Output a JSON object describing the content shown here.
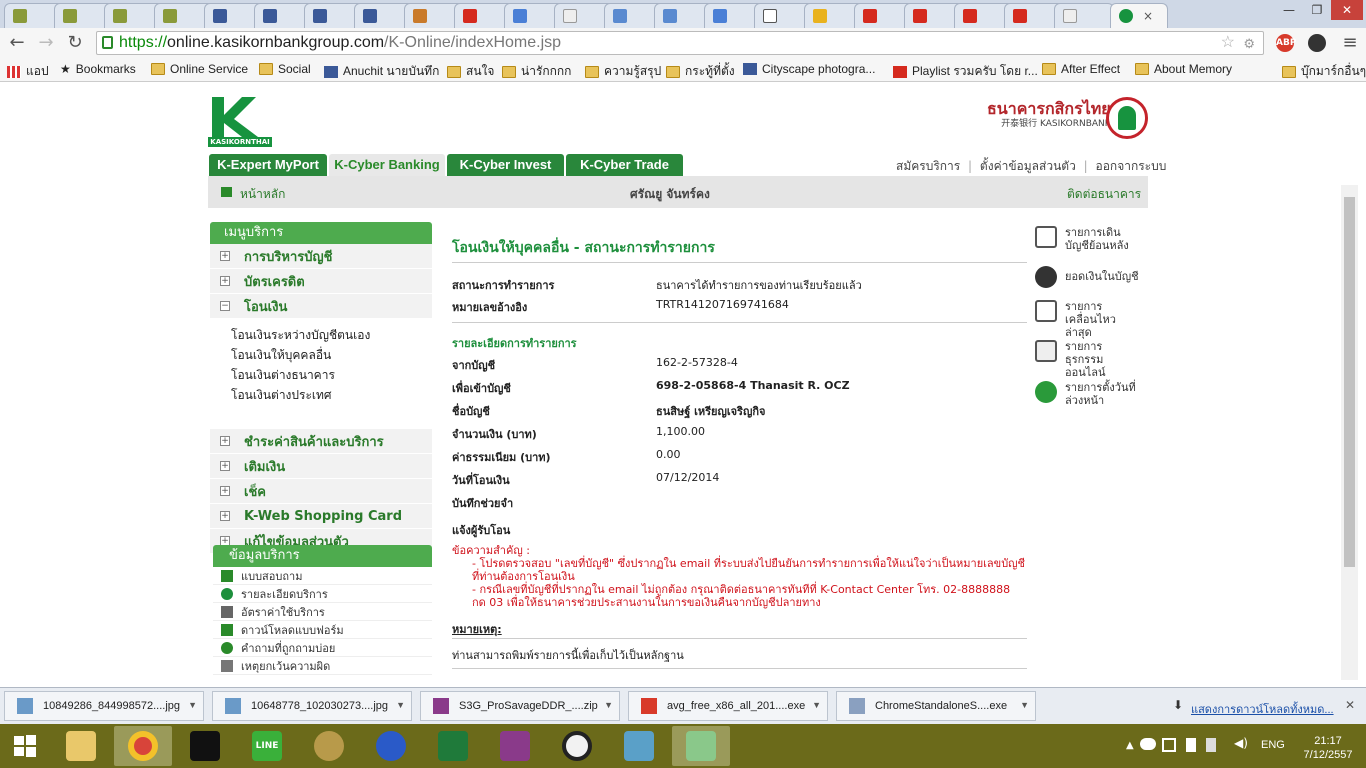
{
  "browser": {
    "active_tab_close": "×",
    "window_controls": [
      "—",
      "❐",
      "✕"
    ],
    "url_https": "https://",
    "url_host": "online.kasikornbankgroup.com",
    "url_path": "/K-Online/indexHome.jsp",
    "extensions": [
      "ABP"
    ]
  },
  "bookmarks": {
    "items": [
      "แอป",
      "Bookmarks",
      "Online Service",
      "Social",
      "Anuchit นายบันทึก",
      "สนใจ",
      "น่ารักกกก",
      "ความรู้สรุป",
      "กระทู้ที่ตั้ง",
      "Cityscape photogra...",
      "Playlist รวมครับ โดย r...",
      "After Effect",
      "About Memory"
    ],
    "other": "บุ๊กมาร์กอื่นๆ"
  },
  "bank": {
    "logo_text": "KASIKORNTHAI",
    "name_th": "ธนาคารกสิกรไทย",
    "name_en": "开泰银行 KASIKORNBANK"
  },
  "tabs": [
    "K-Expert MyPort",
    "K-Cyber Banking",
    "K-Cyber Invest",
    "K-Cyber Trade"
  ],
  "toplinks": [
    "สมัครบริการ",
    "ตั้งค่าข้อมูลส่วนตัว",
    "ออกจากระบบ"
  ],
  "subbar": {
    "home": "หน้าหลัก",
    "user": "ศรัณยู จันทร์คง",
    "contact": "ติดต่อธนาคาร"
  },
  "sidebar": {
    "title": "เมนูบริการ",
    "items": [
      "การบริหารบัญชี",
      "บัตรเครดิต",
      "โอนเงิน"
    ],
    "sub": [
      "โอนเงินระหว่างบัญชีตนเอง",
      "โอนเงินให้บุคคลอื่น",
      "โอนเงินต่างธนาคาร",
      "โอนเงินต่างประเทศ"
    ],
    "items2": [
      "ชำระค่าสินค้าและบริการ",
      "เติมเงิน",
      "เช็ค",
      "K-Web Shopping Card",
      "แก้ไขข้อมูลส่วนตัว"
    ],
    "plus": "+",
    "minus": "−"
  },
  "info": {
    "title": "ข้อมูลบริการ",
    "items": [
      "แบบสอบถาม",
      "รายละเอียดบริการ",
      "อัตราค่าใช้บริการ",
      "ดาวน์โหลดแบบฟอร์ม",
      "คำถามที่ถูกถามบ่อย",
      "เหตุยกเว้นความผิด"
    ]
  },
  "main": {
    "title": "โอนเงินให้บุคคลอื่น - สถานะการทำรายการ",
    "status_label": "สถานะการทำรายการ",
    "status_value": "ธนาคารได้ทำรายการของท่านเรียบร้อยแล้ว",
    "ref_label": "หมายเลขอ้างอิง",
    "ref_value": "TRTR141207169741684",
    "detail_title": "รายละเอียดการทำรายการ",
    "from_label": "จากบัญชี",
    "from_value": "162-2-57328-4",
    "to_label": "เพื่อเข้าบัญชี",
    "to_value": "698-2-05868-4 Thanasit R. OCZ",
    "name_label": "ชื่อบัญชี",
    "name_value": "ธนสิษฐ์ เหรียญเจริญกิจ",
    "amount_label": "จำนวนเงิน (บาท)",
    "amount_value": "1,100.00",
    "fee_label": "ค่าธรรมเนียม (บาท)",
    "fee_value": "0.00",
    "date_label": "วันที่โอนเงิน",
    "date_value": "07/12/2014",
    "memo_label": "บันทึกช่วยจำ",
    "notify_label": "แจ้งผู้รับโอน",
    "warn_title": "ข้อความสำคัญ :",
    "warn1": "- โปรดตรวจสอบ \"เลขที่บัญชี\" ซึ่งปรากฏใน email ที่ระบบส่งไปยืนยันการทำรายการเพื่อให้แน่ใจว่าเป็นหมายเลขบัญชีที่ท่านต้องการโอนเงิน",
    "warn2": "- กรณีเลขที่บัญชีที่ปรากฏใน email ไม่ถูกต้อง กรุณาติดต่อธนาคารทันทีที่ K-Contact Center โทร. 02-8888888 กด 03 เพื่อให้ธนาคารช่วยประสานงานในการขอเงินคืนจากบัญชีปลายทาง",
    "note_label": "หมายเหตุ:",
    "note_text": "ท่านสามารถพิมพ์รายการนี้เพื่อเก็บไว้เป็นหลักฐาน"
  },
  "rightpanel": {
    "items": [
      "รายการเดินบัญชีย้อนหลัง",
      "ยอดเงินในบัญชี",
      "รายการเคลื่อนไหวล่าสุด",
      "รายการธุรกรรมออนไลน์",
      "รายการตั้งวันที่ล่วงหน้า"
    ]
  },
  "downloads": {
    "items": [
      "10849286_844998572....jpg",
      "10648778_102030273....jpg",
      "S3G_ProSavageDDR_....zip",
      "avg_free_x86_all_201....exe",
      "ChromeStandaloneS....exe"
    ],
    "show_all": "แสดงการดาวน์โหลดทั้งหมด..."
  },
  "taskbar": {
    "lang": "ENG",
    "time": "21:17",
    "date": "7/12/2557",
    "line_label": "LINE"
  }
}
